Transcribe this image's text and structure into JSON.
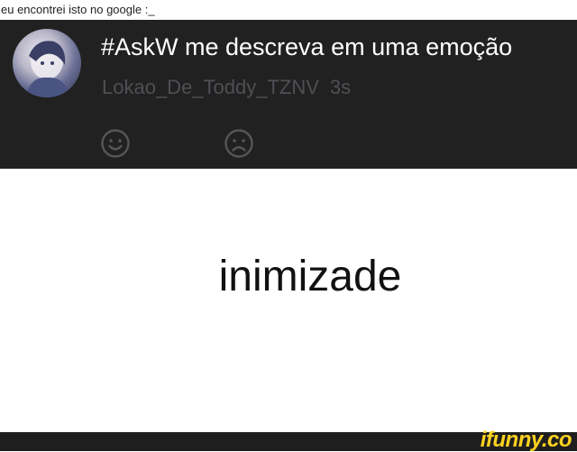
{
  "caption": "eu encontrei isto no google :_",
  "post": {
    "title": "#AskW me descreva em uma emoção",
    "username": "Lokao_De_Toddy_TZNV",
    "time": "3s",
    "reactions": [
      "smile-icon",
      "sad-face-icon"
    ]
  },
  "answer": "inimizade",
  "footer": {
    "brand": "ifunny.co"
  },
  "colors": {
    "post_bg": "#212121",
    "meta_text": "#4f4f55",
    "brand": "#ffd21f"
  }
}
